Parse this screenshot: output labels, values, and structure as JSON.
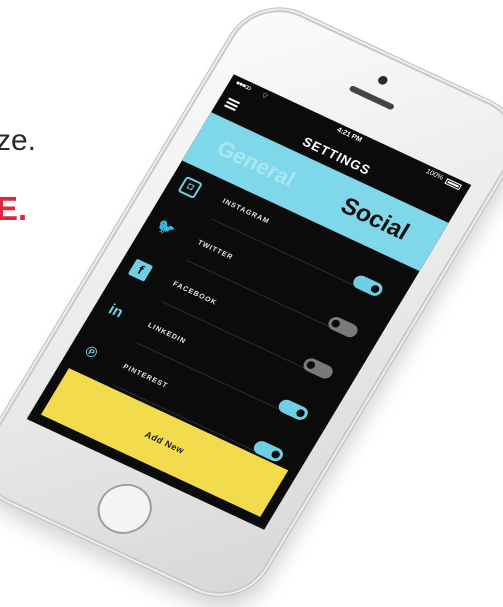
{
  "background_text": {
    "line1": "ze.",
    "line2": "E."
  },
  "status_bar": {
    "signal": "●●●oo",
    "time": "4:21 PM",
    "battery": "100%"
  },
  "nav": {
    "title": "SETTINGS",
    "menu_icon": "hamburger-icon"
  },
  "tabs": [
    {
      "label": "General",
      "active": false
    },
    {
      "label": "Social",
      "active": true
    }
  ],
  "social_accounts": [
    {
      "label": "INSTAGRAM",
      "icon": "instagram-icon",
      "glyph": "◘",
      "enabled": null
    },
    {
      "label": "TWITTER",
      "icon": "twitter-icon",
      "glyph": "🐦",
      "enabled": true
    },
    {
      "label": "FACEBOOK",
      "icon": "facebook-icon",
      "glyph": "f",
      "enabled": false
    },
    {
      "label": "LINKEDIN",
      "icon": "linkedin-icon",
      "glyph": "in",
      "enabled": false
    },
    {
      "label": "PINTEREST",
      "icon": "pinterest-icon",
      "glyph": "℗",
      "enabled": true
    }
  ],
  "extra_toggle_enabled": true,
  "add_button_label": "Add New",
  "colors": {
    "accent": "#6fcfe3",
    "tab_bar": "#7fd8ea",
    "add_button": "#f2dc4d",
    "screen_bg": "#0b0b0b",
    "brand_red": "#e0263a"
  }
}
